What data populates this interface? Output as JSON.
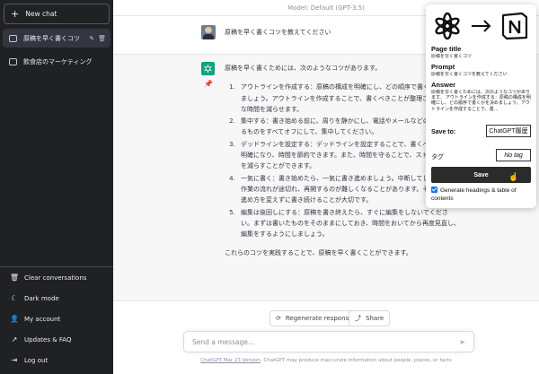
{
  "sidebar": {
    "new_chat": "New chat",
    "chats": [
      {
        "label": "原稿を早く書くコツ",
        "active": true
      },
      {
        "label": "飲食店のマーケティング",
        "active": false
      }
    ],
    "bottom": [
      {
        "label": "Clear conversations",
        "icon": "trash-icon"
      },
      {
        "label": "Dark mode",
        "icon": "moon-icon"
      },
      {
        "label": "My account",
        "icon": "user-icon"
      },
      {
        "label": "Updates & FAQ",
        "icon": "external-link-icon"
      },
      {
        "label": "Log out",
        "icon": "logout-icon"
      }
    ]
  },
  "main": {
    "model": "Model: Default (GPT-3.5)",
    "user_message": "原稿を早く書くコツを教えてください",
    "answer_intro": "原稿を早く書くためには、次のようなコツがあります。",
    "answer_items": [
      "アウトラインを作成する：原稿の構成を明確にし、どの順序で書くかを決めましょう。アウトラインを作成することで、書くべきことが整理され、無駄な時間を減らせます。",
      "集中する：書き始める前に、周りを静かにし、電話やメールなどの妨げになるものをすべてオフにして、集中してください。",
      "デッドラインを設定する：デッドラインを設定することで、書くべき期限が明確になり、時間を節約できます。また、時間を守ることで、ストレスや焦りを減らすことができます。",
      "一気に書く：書き始めたら、一気に書き進めましょう。中断してしまうと、作業の流れが途切れ、再開するのが難しくなることがあります。そのため、進め方を変えずに書き続けることが大切です。",
      "編集は後回しにする：原稿を書き終えたら、すぐに編集をしないでください。まずは書いたものをそのままにしておき、時間をおいてから再度見直し、編集をするようにしましょう。"
    ],
    "answer_outro": "これらのコツを実践することで、原稿を早く書くことができます。",
    "regenerate": "Regenerate response",
    "share": "Share",
    "send_placeholder": "Send a message...",
    "footer_link": "ChatGPT Mar 23 Version",
    "footer_text": ". ChatGPT may produce inaccurate information about people, places, or facts"
  },
  "popup": {
    "page_title_label": "Page title",
    "page_title_value": "原稿を早く書くコツ",
    "prompt_label": "Prompt",
    "prompt_value": "原稿を早く書くコツを教えてください",
    "answer_label": "Answer",
    "answer_value": "原稿を早く書くためには、次のようなコツがあります。 アウトラインを作成する：原稿の構成を明確にし、どの順序で書くかを決めましょう。アウトラインを作成することで、書…",
    "save_to_label": "Save to:",
    "save_to_value": "ChatGPT履歴",
    "tag_label": "タグ",
    "tag_value": "No tag",
    "save_button": "Save",
    "generate_label": "Generate headings & table of contents",
    "generate_checked": true
  },
  "colors": {
    "sidebar_bg": "#202123",
    "accent_green": "#10a37f",
    "save_bg": "#2b2b2b",
    "checkbox": "#1a73e8"
  }
}
